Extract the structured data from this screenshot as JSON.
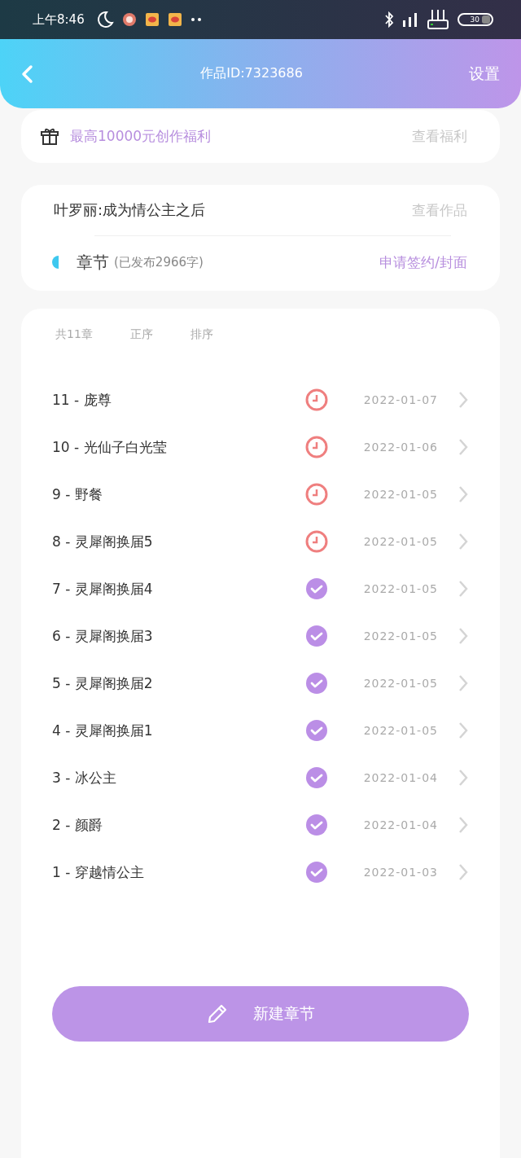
{
  "status_bar": {
    "time": "上午8:46",
    "battery": "30"
  },
  "header": {
    "title": "作品ID:7323686",
    "settings": "设置"
  },
  "benefit": {
    "text": "最高10000元创作福利",
    "link": "查看福利"
  },
  "work": {
    "title": "叶罗丽:成为情公主之后",
    "view_link": "查看作品",
    "chapters_label": "章节",
    "published_info": "(已发布2966字)",
    "apply_link": "申请签约/封面"
  },
  "list_header": {
    "count": "共11章",
    "order": "正序",
    "sort": "排序"
  },
  "chapters": [
    {
      "title": "11 - 庞尊",
      "published": false,
      "date": "2022-01-07"
    },
    {
      "title": "10 - 光仙子白光莹",
      "published": false,
      "date": "2022-01-06"
    },
    {
      "title": "9 - 野餐",
      "published": false,
      "date": "2022-01-05"
    },
    {
      "title": "8 - 灵犀阁换届5",
      "published": false,
      "date": "2022-01-05"
    },
    {
      "title": "7 - 灵犀阁换届4",
      "published": true,
      "date": "2022-01-05"
    },
    {
      "title": "6 - 灵犀阁换届3",
      "published": true,
      "date": "2022-01-05"
    },
    {
      "title": "5 - 灵犀阁换届2",
      "published": true,
      "date": "2022-01-05"
    },
    {
      "title": "4 - 灵犀阁换届1",
      "published": true,
      "date": "2022-01-05"
    },
    {
      "title": "3 - 冰公主",
      "published": true,
      "date": "2022-01-04"
    },
    {
      "title": "2 - 颜爵",
      "published": true,
      "date": "2022-01-04"
    },
    {
      "title": "1 - 穿越情公主",
      "published": true,
      "date": "2022-01-03"
    }
  ],
  "new_chapter_button": "新建章节"
}
